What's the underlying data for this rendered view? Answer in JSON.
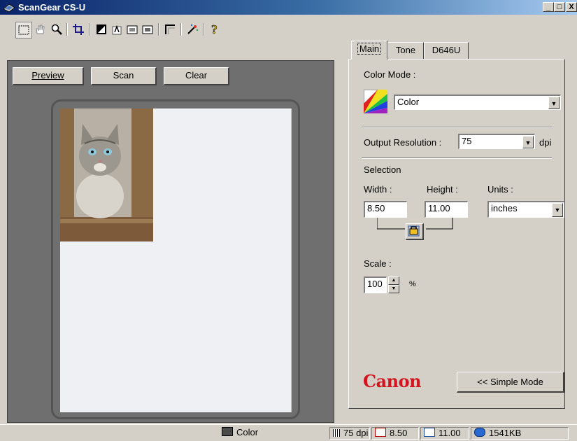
{
  "window": {
    "title": "ScanGear CS-U",
    "controls": {
      "minimize": "_",
      "maximize": "□",
      "close": "X"
    }
  },
  "toolbar": {
    "icons": [
      "marquee-select-icon",
      "hand-icon",
      "zoom-icon",
      "crop-icon",
      "auto-tone-icon",
      "mirror-icon",
      "rotate-left-icon",
      "rotate-right-icon",
      "corner-icon",
      "auto-adjust-icon",
      "help-icon"
    ]
  },
  "preview": {
    "preview_label": "Preview",
    "scan_label": "Scan",
    "clear_label": "Clear"
  },
  "tabs": [
    {
      "label": "Main",
      "active": true
    },
    {
      "label": "Tone",
      "active": false
    },
    {
      "label": "D646U",
      "active": false
    }
  ],
  "main": {
    "color_mode_label": "Color Mode :",
    "color_mode_value": "Color",
    "output_resolution_label": "Output Resolution :",
    "output_resolution_value": "75",
    "dpi_label": "dpi",
    "selection_label": "Selection",
    "width_label": "Width :",
    "height_label": "Height :",
    "units_label": "Units :",
    "width_value": "8.50",
    "height_value": "11.00",
    "units_value": "inches",
    "scale_label": "Scale :",
    "scale_value": "100",
    "percent_label": "%",
    "brand": "Canon",
    "simple_mode_label": "<< Simple Mode"
  },
  "status": {
    "color_mode": "Color",
    "resolution": "75 dpi",
    "width": "8.50",
    "height": "11.00",
    "file_size": "1541KB"
  },
  "colors": {
    "brand_red": "#d2141e",
    "title_blue": "#0a246a",
    "face": "#d4d0c8"
  }
}
